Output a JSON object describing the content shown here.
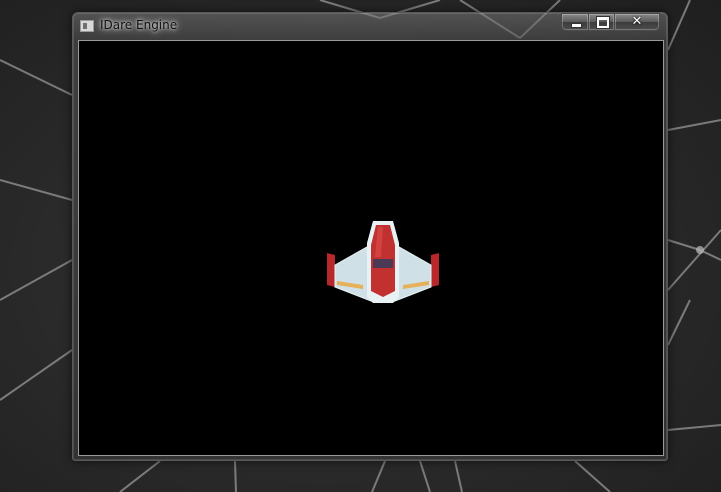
{
  "window": {
    "title": "IDare Engine",
    "icon": "application-window-icon"
  },
  "caption_buttons": {
    "minimize_icon": "minimize-icon",
    "maximize_icon": "maximize-icon",
    "close_icon": "close-icon",
    "close_glyph": "✕"
  },
  "game": {
    "background_color": "#000000",
    "sprite": "spaceship",
    "sprite_colors": {
      "hull": "#cfe0e6",
      "body": "#c1312f",
      "cockpit": "#4a3a55",
      "wing_tips": "#b8282a",
      "wing_stripe": "#e6b15a"
    }
  }
}
